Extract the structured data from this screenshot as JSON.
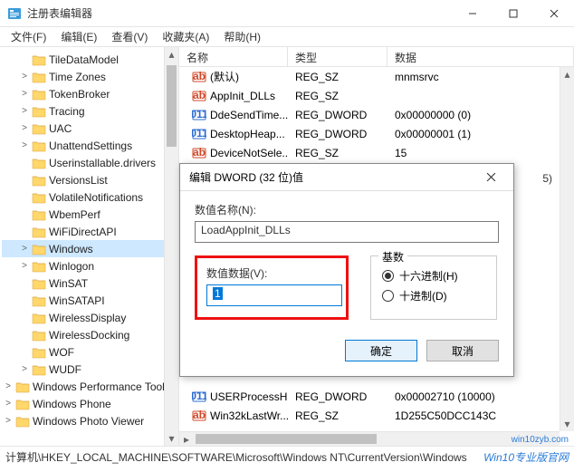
{
  "window": {
    "title": "注册表编辑器"
  },
  "menu": {
    "file": "文件(F)",
    "edit": "编辑(E)",
    "view": "查看(V)",
    "favorites": "收藏夹(A)",
    "help": "帮助(H)"
  },
  "tree": {
    "items": [
      {
        "label": "TileDataModel",
        "exp": ""
      },
      {
        "label": "Time Zones",
        "exp": ">"
      },
      {
        "label": "TokenBroker",
        "exp": ">"
      },
      {
        "label": "Tracing",
        "exp": ">"
      },
      {
        "label": "UAC",
        "exp": ">"
      },
      {
        "label": "UnattendSettings",
        "exp": ">"
      },
      {
        "label": "Userinstallable.drivers",
        "exp": ""
      },
      {
        "label": "VersionsList",
        "exp": ""
      },
      {
        "label": "VolatileNotifications",
        "exp": ""
      },
      {
        "label": "WbemPerf",
        "exp": ""
      },
      {
        "label": "WiFiDirectAPI",
        "exp": ""
      },
      {
        "label": "Windows",
        "exp": ">",
        "selected": true
      },
      {
        "label": "Winlogon",
        "exp": ">"
      },
      {
        "label": "WinSAT",
        "exp": ""
      },
      {
        "label": "WinSATAPI",
        "exp": ""
      },
      {
        "label": "WirelessDisplay",
        "exp": ""
      },
      {
        "label": "WirelessDocking",
        "exp": ""
      },
      {
        "label": "WOF",
        "exp": ""
      },
      {
        "label": "WUDF",
        "exp": ">"
      }
    ],
    "root": [
      {
        "label": "Windows Performance Toolk",
        "exp": ">"
      },
      {
        "label": "Windows Phone",
        "exp": ">"
      },
      {
        "label": "Windows Photo Viewer",
        "exp": ">"
      }
    ]
  },
  "list": {
    "head": {
      "name": "名称",
      "type": "类型",
      "data": "数据"
    },
    "rows": [
      {
        "icon": "str",
        "name": "(默认)",
        "type": "REG_SZ",
        "data": "mnmsrvc"
      },
      {
        "icon": "str",
        "name": "AppInit_DLLs",
        "type": "REG_SZ",
        "data": ""
      },
      {
        "icon": "bin",
        "name": "DdeSendTime...",
        "type": "REG_DWORD",
        "data": "0x00000000 (0)"
      },
      {
        "icon": "bin",
        "name": "DesktopHeap...",
        "type": "REG_DWORD",
        "data": "0x00000001 (1)"
      },
      {
        "icon": "str",
        "name": "DeviceNotSele...",
        "type": "REG_SZ",
        "data": "15"
      },
      {
        "icon": "bin",
        "name": "USERProcessH...",
        "type": "REG_DWORD",
        "data": "0x00002710 (10000)"
      },
      {
        "icon": "str",
        "name": "Win32kLastWr...",
        "type": "REG_SZ",
        "data": "1D255C50DCC143C"
      }
    ],
    "hidden_row_data": "5)"
  },
  "dialog": {
    "title": "编辑 DWORD (32 位)值",
    "name_label": "数值名称(N):",
    "name_value": "LoadAppInit_DLLs",
    "value_label": "数值数据(V):",
    "value_value": "1",
    "radix_label": "基数",
    "radix_hex": "十六进制(H)",
    "radix_dec": "十进制(D)",
    "ok": "确定",
    "cancel": "取消"
  },
  "statusbar": {
    "path": "计算机\\HKEY_LOCAL_MACHINE\\SOFTWARE\\Microsoft\\Windows NT\\CurrentVersion\\Windows"
  },
  "watermark": {
    "small": "win10zyb.com",
    "big": "Win10专业版官网"
  }
}
